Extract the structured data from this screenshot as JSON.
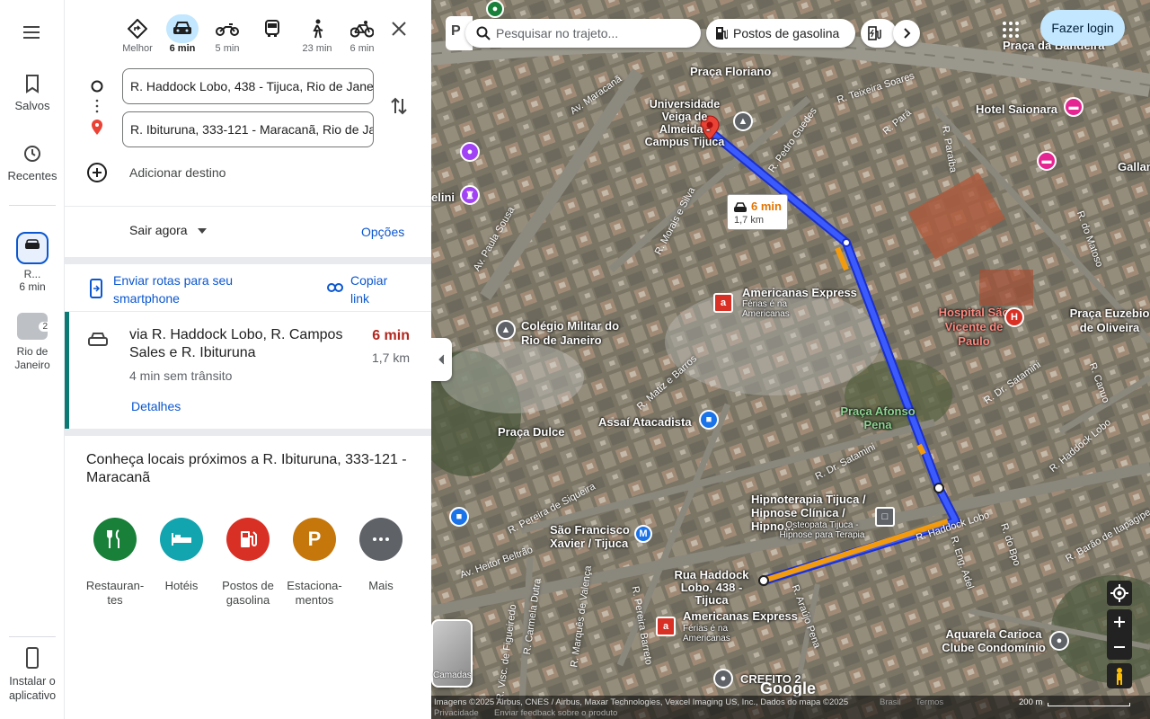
{
  "rail": {
    "saved_label": "Salvos",
    "recent_label": "Recentes",
    "trip_label": "R...",
    "trip_time": "6 min",
    "rio_label": "Rio de Janeiro",
    "rio_badge": "2",
    "install_label": "Instalar o aplicativo"
  },
  "modes": [
    {
      "label": "Melhor"
    },
    {
      "label": "6 min"
    },
    {
      "label": "5 min"
    },
    {
      "label": ""
    },
    {
      "label": "23 min"
    },
    {
      "label": "6 min"
    }
  ],
  "route": {
    "origin": "R. Haddock Lobo, 438 - Tijuca, Rio de Janeiro",
    "destination": "R. Ibituruna, 333-121 - Maracanã, Rio de Janeiro",
    "add_destination": "Adicionar destino",
    "depart": "Sair agora",
    "options": "Opções",
    "send_to_phone": "Enviar rotas para seu smartphone",
    "copy_link": "Copiar link",
    "via": "via R. Haddock Lobo, R. Campos Sales e R. Ibituruna",
    "duration": "6 min",
    "distance": "1,7 km",
    "no_traffic": "4 min sem trânsito",
    "details": "Detalhes"
  },
  "nearby": {
    "title": "Conheça locais próximos a R. Ibituruna, 333-121 - Maracanã",
    "categories": [
      {
        "label": "Restauran-tes",
        "icon": "fork-knife-icon",
        "color": "#188038"
      },
      {
        "label": "Hotéis",
        "icon": "bed-icon",
        "color": "#12a4af"
      },
      {
        "label": "Postos de gasolina",
        "icon": "fuel-icon",
        "color": "#d93025"
      },
      {
        "label": "Estaciona-mentos",
        "icon": "P",
        "color": "#c5770b"
      },
      {
        "label": "Mais",
        "icon": "more-icon",
        "color": "#5f6368"
      }
    ]
  },
  "map": {
    "search_placeholder": "Pesquisar no trajeto...",
    "chip_fuel": "Postos de gasolina",
    "login": "Fazer login",
    "route_bubble_time": "6 min",
    "route_bubble_dist": "1,7 km",
    "layers_label": "Camadas",
    "google": "Google",
    "attribution": "Imagens ©2025 Airbus, CNES / Airbus, Maxar Technologies, Vexcel Imaging US, Inc., Dados do mapa ©2025",
    "brasil": "Brasil",
    "terms": "Termos",
    "privacy": "Privacidade",
    "feedback": "Enviar feedback sobre o produto",
    "scale": "200 m",
    "labels": {
      "praca_bandeira": "Praça da Bandeira",
      "praca_floriano": "Praça Floriano",
      "universidade": "Universidade Veiga de Almeida - Campus Tijuca",
      "hotel": "Hotel Saionara",
      "gallant": "Gallant",
      "americanas1": "Americanas Express",
      "americanas1_sub": "Férias é na Americanas",
      "hospital": "Hospital São Vicente de Paulo",
      "praca_euzebio": "Praça Euzebio de Oliveira",
      "colegio": "Colégio Militar do Rio de Janeiro",
      "assai": "Assaí Atacadista",
      "praca_dulce": "Praça Dulce",
      "praca_afonso": "Praça Afonso Pena",
      "hipnoterapia": "Hipnoterapia Tijuca / Hipnose Clínica / Hipno...",
      "hipno_sub": "Osteopata Tijuca - Hipnose para Terapia",
      "sao_francisco": "São Francisco Xavier / Tijuca",
      "origin_label": "Rua Haddock Lobo, 438 - Tijuca",
      "americanas2": "Americanas Express",
      "americanas2_sub": "Férias é na Americanas",
      "aquarela": "Aquarela Carioca Clube Condomínio",
      "crefito": "CREFITO 2",
      "elini": "elini"
    },
    "streets": {
      "av_maracana": "Av. Maracanã",
      "r_teixeira": "R. Teixeira Soares",
      "r_para": "R. Pará",
      "r_paraiba": "R. Paraíba",
      "r_pedro": "R. Pedro Guedes",
      "r_morais": "R. Morais e Silva",
      "av_paula": "Av. Paula Sousa",
      "r_matoso": "R. do Matoso",
      "r_matiz": "R. Matiz e Barros",
      "r_salamini": "R. Dr. Satamini",
      "r_salamini2": "R. Dr. Satamini",
      "r_siqueira": "R. Pereira de Siqueira",
      "r_haddock": "R. Haddock Lobo",
      "r_haddock2": "R. Haddock Lobo",
      "r_eng": "R. Eng. Adel",
      "r_bpo": "R. do Bpo",
      "r_barao": "R. Barão de Itapagipe",
      "av_heitor": "Av. Heitor Beltrão",
      "r_carmela": "R. Carmela Dutra",
      "r_marques": "R. Marquês de Valença",
      "r_pereira": "R. Pereira Barreto",
      "r_aratijo": "R. Araújo Pena",
      "r_vis": "R. Visc. de Figueiredo",
      "r_campo": "R. Canuo"
    }
  }
}
